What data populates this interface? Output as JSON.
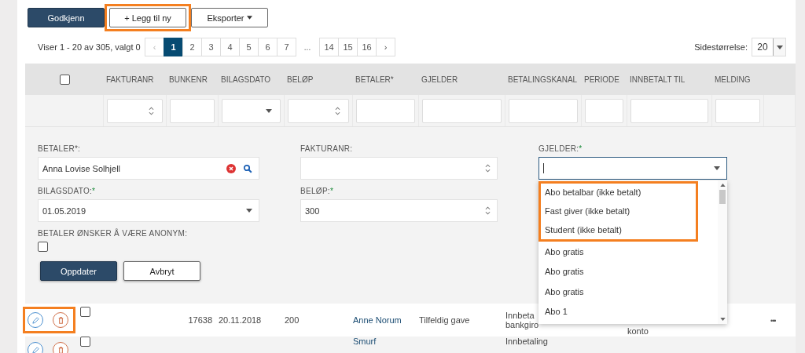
{
  "toolbar": [
    {
      "label": "Godkjenn",
      "kind": "primary",
      "highlighted": false
    },
    {
      "label": "+ Legg til ny",
      "kind": "default",
      "highlighted": true
    },
    {
      "label": "Eksporter",
      "kind": "dropdown",
      "highlighted": false
    }
  ],
  "pagination": {
    "summary": "Viser 1 - 20 av 305, valgt 0",
    "prev": "‹",
    "next": "›",
    "ellipsis": "...",
    "pages": [
      {
        "label": "1",
        "selected": true
      },
      {
        "label": "2",
        "selected": false
      },
      {
        "label": "3",
        "selected": false
      },
      {
        "label": "4",
        "selected": false
      },
      {
        "label": "5",
        "selected": false
      },
      {
        "label": "6",
        "selected": false
      },
      {
        "label": "7",
        "selected": false
      }
    ],
    "last_pages": [
      {
        "label": "14",
        "selected": false
      },
      {
        "label": "15",
        "selected": false
      },
      {
        "label": "16",
        "selected": false
      }
    ],
    "page_size_label": "Sidestørrelse:",
    "page_size": "20"
  },
  "table": {
    "select_all_checked": false,
    "columns": [
      {
        "label": "FAKTURANR",
        "kind": "spinner"
      },
      {
        "label": "BUNKENR",
        "kind": "text"
      },
      {
        "label": "BILAGSDATO",
        "kind": "select"
      },
      {
        "label": "BELØP",
        "kind": "spinner"
      },
      {
        "label": "BETALER*",
        "kind": "text"
      },
      {
        "label": "GJELDER",
        "kind": "text"
      },
      {
        "label": "BETALINGSKANAL",
        "kind": "text"
      },
      {
        "label": "PERIODE",
        "kind": "text"
      },
      {
        "label": "INNBETALT TIL",
        "kind": "text"
      },
      {
        "label": "MELDING",
        "kind": "text"
      }
    ],
    "edit_form": {
      "betaler": {
        "label": "BETALER*:",
        "value": "Anna Lovise Solhjell"
      },
      "fakturanr": {
        "label": "FAKTURANR:"
      },
      "gjelder": {
        "label": "GJELDER:",
        "required_mark": "*",
        "expanded": true,
        "options": [
          {
            "label": "Abo betalbar (ikke betalt)",
            "highlighted": true
          },
          {
            "label": "Fast giver (ikke betalt)",
            "highlighted": true
          },
          {
            "label": "Student (ikke betalt)",
            "highlighted": true
          },
          {
            "label": "Abo gratis",
            "highlighted": false
          },
          {
            "label": "Abo gratis",
            "highlighted": false
          },
          {
            "label": "Abo gratis",
            "highlighted": false
          },
          {
            "label": "Abo 1",
            "highlighted": false
          }
        ]
      },
      "bilagsdato": {
        "label": "BILAGSDATO:",
        "required_mark": "*",
        "value": "01.05.2019"
      },
      "belop": {
        "label": "BELØP:",
        "required_mark": "*",
        "value": "300"
      },
      "anonym": {
        "label": "BETALER ØNSKER Å VÆRE ANONYM:",
        "checked": false
      },
      "buttons": [
        {
          "label": "Oppdater",
          "kind": "primary"
        },
        {
          "label": "Avbryt",
          "kind": "default"
        }
      ]
    },
    "rows": [
      {
        "checked": false,
        "actions_highlighted": true,
        "bunkenr": "17638",
        "bilagsdato": "20.11.2018",
        "belop": "200",
        "betaler": "Anne Norum",
        "gjelder": "Tilfeldig gave",
        "betalingskanal": [
          "Innbeta",
          "bankgiro"
        ],
        "innbetalt_til": "konto",
        "more": "•••"
      },
      {
        "checked": false,
        "actions_highlighted": false,
        "betaler": "Smurf",
        "betalingskanal": [
          "Innbetaling"
        ]
      }
    ]
  }
}
